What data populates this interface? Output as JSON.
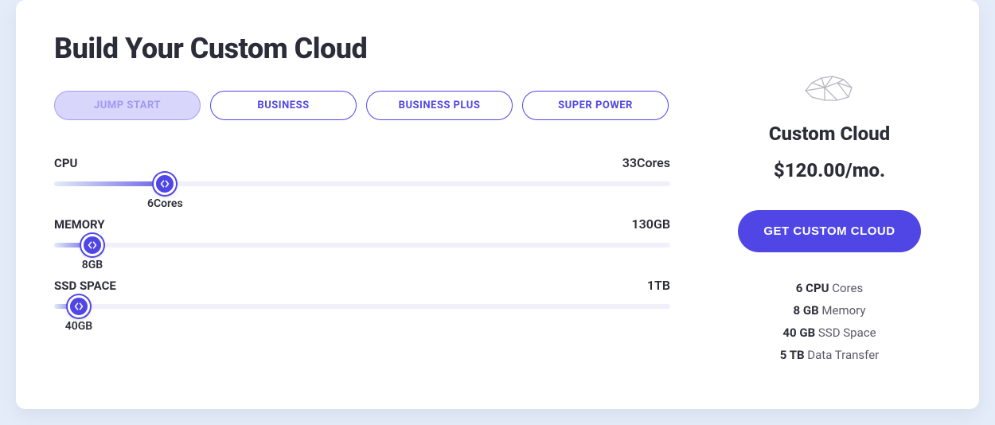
{
  "title": "Build Your Custom Cloud",
  "tabs": [
    {
      "label": "JUMP START",
      "active": true
    },
    {
      "label": "BUSINESS",
      "active": false
    },
    {
      "label": "BUSINESS PLUS",
      "active": false
    },
    {
      "label": "SUPER POWER",
      "active": false
    }
  ],
  "sliders": {
    "cpu": {
      "label": "CPU",
      "max": "33Cores",
      "value": "6Cores",
      "percent": 18
    },
    "memory": {
      "label": "MEMORY",
      "max": "130GB",
      "value": "8GB",
      "percent": 6.2
    },
    "ssd": {
      "label": "SSD SPACE",
      "max": "1TB",
      "value": "40GB",
      "percent": 4
    }
  },
  "summary": {
    "icon": "cloud-poly-icon",
    "name": "Custom Cloud",
    "price": "$120.00/mo.",
    "cta": "GET CUSTOM CLOUD",
    "specs": [
      {
        "bold": "6 CPU",
        "rest": " Cores"
      },
      {
        "bold": "8 GB",
        "rest": " Memory"
      },
      {
        "bold": "40 GB",
        "rest": " SSD Space"
      },
      {
        "bold": "5 TB",
        "rest": " Data Transfer"
      }
    ]
  },
  "colors": {
    "accent": "#5046e5"
  }
}
